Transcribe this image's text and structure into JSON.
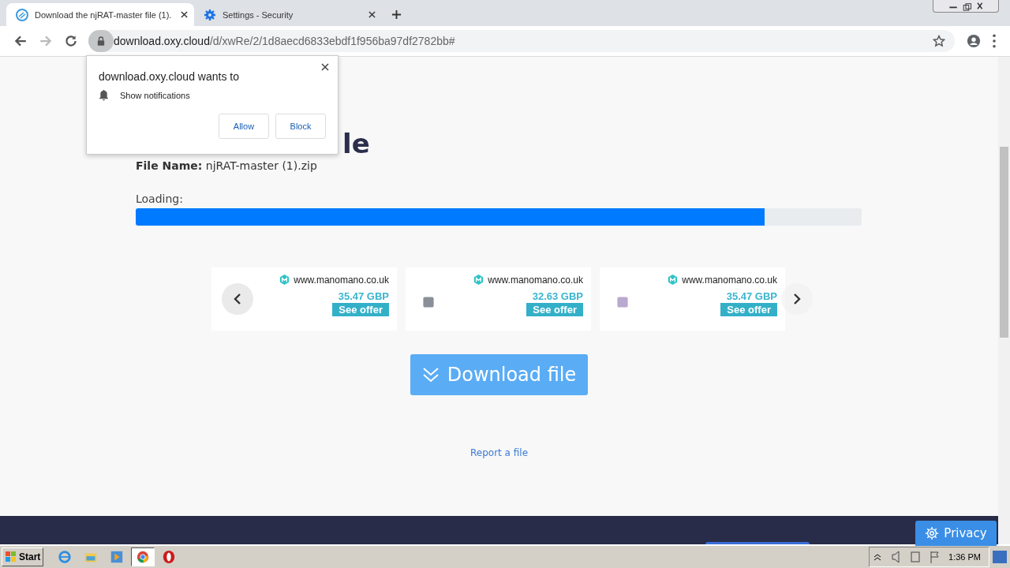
{
  "tabs": [
    {
      "kind": "page",
      "title": "Download the njRAT-master file (1).",
      "selected": true
    },
    {
      "kind": "settings",
      "title": "Settings - Security",
      "selected": false
    }
  ],
  "address": {
    "host": "download.oxy.cloud",
    "path": "/d/xwRe/2/1d8aecd6833ebdf1f956ba97df2782bb#"
  },
  "popup": {
    "title": "download.oxy.cloud wants to",
    "permission": "Show notifications",
    "buttons": [
      "Allow",
      "Block"
    ]
  },
  "page": {
    "heading_visible": "le",
    "file_label": "File Name:",
    "file_name": "njRAT-master (1).zip",
    "loading_label": "Loading:",
    "progress": {
      "level": 0.866
    },
    "offers": [
      {
        "source": "www.manomano.co.uk",
        "price": "35.47 GBP",
        "button": "See offer"
      },
      {
        "source": "www.manomano.co.uk",
        "price": "32.63 GBP",
        "button": "See offer"
      },
      {
        "source": "www.manomano.co.uk",
        "price": "35.47 GBP",
        "button": "See offer"
      }
    ],
    "download_button": "Download file",
    "report_link": "Report a file"
  },
  "privacy_button": "Privacy",
  "taskbar": {
    "start": "Start",
    "apps": [
      {
        "kind": "ie",
        "selected": false
      },
      {
        "kind": "folder",
        "selected": false
      },
      {
        "kind": "media",
        "selected": false
      },
      {
        "kind": "chrome",
        "selected": true
      },
      {
        "kind": "opera",
        "selected": false
      }
    ],
    "clock": "1:36 PM"
  }
}
